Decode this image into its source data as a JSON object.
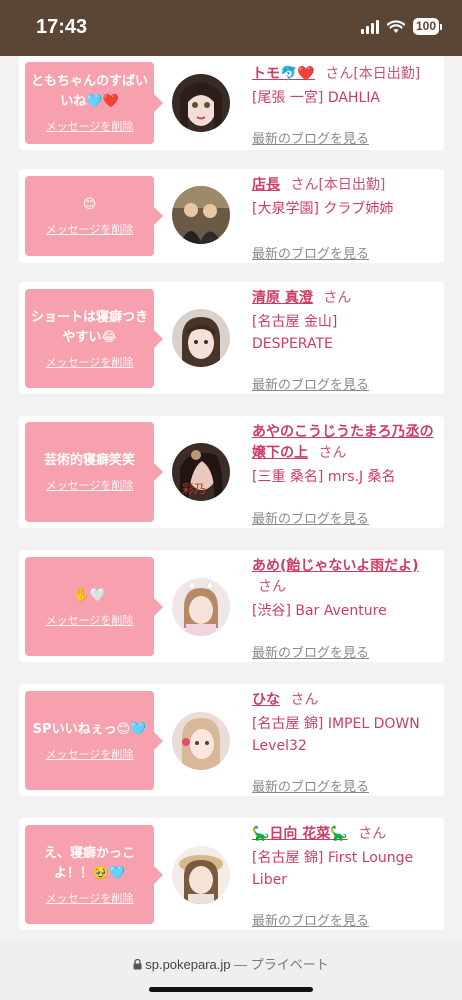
{
  "status_bar": {
    "time": "17:43",
    "battery": "100"
  },
  "common": {
    "delete_label": "メッセージを削除",
    "blog_label": "最新のブログを見る",
    "honorific": "さん"
  },
  "cards": [
    {
      "message": "ともちゃんのすばいいね🩵❤️",
      "name": "トモ🐬❤️",
      "status": "[本日出勤]",
      "shop": "[尾張 一宮] DAHLIA"
    },
    {
      "message": "😊",
      "name": "店長",
      "status": "[本日出勤]",
      "shop": "[大泉学園] クラブ姉姉"
    },
    {
      "message": "ショートは寝癖つきやすい😂",
      "name": "清原 真澄",
      "status": "",
      "shop": "[名古屋 金山] DESPERATE"
    },
    {
      "message": "芸術的寝癖笑笑",
      "name": "あやのこうじうたまろ乃丞の嬢下の上",
      "status": "",
      "shop": "[三重 桑名] mrs.J 桑名"
    },
    {
      "message": "✋🤍",
      "name": "あめ(飴じゃないよ雨だよ)",
      "status": "",
      "shop": "[渋谷] Bar Aventure"
    },
    {
      "message": "SPいいねぇっ😊🩵",
      "name": "ひな",
      "status": "",
      "shop": "[名古屋 錦] IMPEL DOWN Level32"
    },
    {
      "message": "え、寝癖かっこよ！！🥹🩵",
      "name": "🦕日向 花菜🦕",
      "status": "",
      "shop": "[名古屋 錦] First Lounge Liber"
    }
  ],
  "browser": {
    "domain": "sp.pokepara.jp",
    "mode": "— プライベート"
  },
  "colors": {
    "bubble": "#f7a1ae",
    "name": "#cc3d63",
    "status_bar": "#5b4636"
  }
}
